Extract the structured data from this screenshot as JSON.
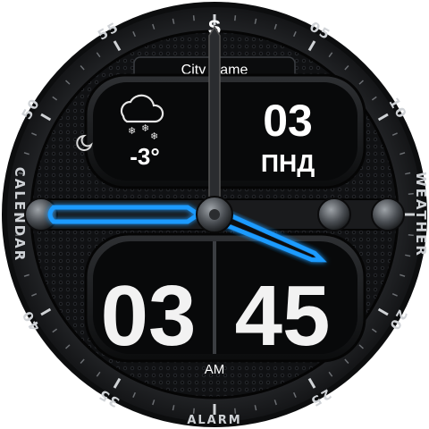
{
  "header": {
    "city": "City Name",
    "logo_glyph": "S"
  },
  "weather": {
    "temperature": "-3°",
    "condition_icon": "snow-cloud-icon",
    "night_icon": "moon-icon"
  },
  "date": {
    "day": "03",
    "weekday": "ПНД"
  },
  "time": {
    "hours": "03",
    "minutes": "45",
    "period": "AM"
  },
  "bezel": {
    "labels": {
      "left": "CALENDAR",
      "right": "WEATHER",
      "bottom": "ALARM"
    },
    "numbers": [
      "55",
      "05",
      "10",
      "50",
      "40",
      "20",
      "35",
      "25"
    ]
  },
  "colors": {
    "accent": "#1e9bff",
    "bezel": "#1c1d1f",
    "panel": "#0d0e10",
    "text": "#ffffff"
  },
  "hands": {
    "hour_angle_deg": 113,
    "minute_angle_deg": 0,
    "second_angle_deg": 354
  }
}
